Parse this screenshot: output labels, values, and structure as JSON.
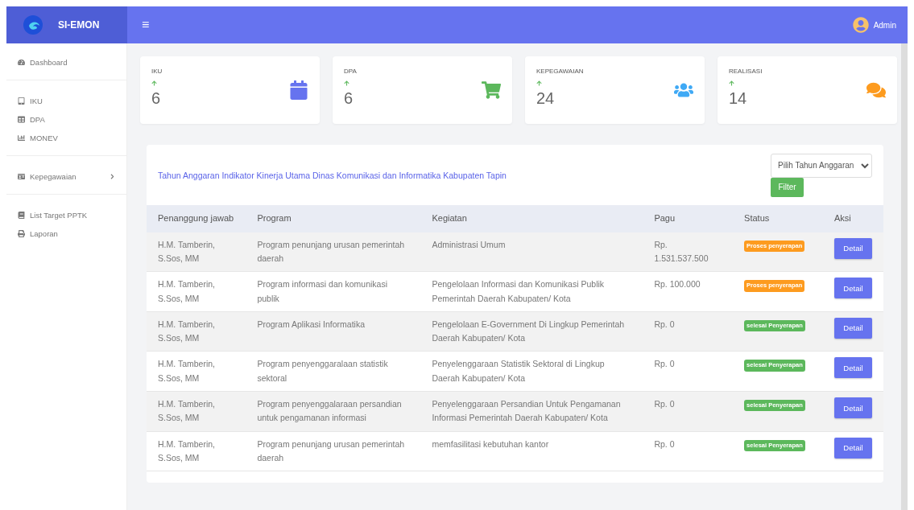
{
  "brand": {
    "name": "SI-EMON"
  },
  "header": {
    "menu_glyph": "≡",
    "user": "Admin"
  },
  "sidebar": {
    "groups": [
      {
        "items": [
          {
            "label": "Dashboard",
            "kind": "link"
          }
        ]
      },
      {
        "items": [
          {
            "label": "IKU",
            "kind": "link"
          },
          {
            "label": "DPA",
            "kind": "link"
          },
          {
            "label": "MONEV",
            "kind": "link"
          }
        ]
      },
      {
        "items": [
          {
            "label": "Kepegawaian",
            "kind": "submenu"
          }
        ]
      },
      {
        "items": [
          {
            "label": "List Target PPTK",
            "kind": "link"
          },
          {
            "label": "Laporan",
            "kind": "link"
          }
        ]
      }
    ]
  },
  "stats": [
    {
      "label": "IKU",
      "value": "6",
      "color": "#6673ef"
    },
    {
      "label": "DPA",
      "value": "6",
      "color": "#5cb85c"
    },
    {
      "label": "KEPEGAWAIAN",
      "value": "24",
      "color": "#3fa9f5"
    },
    {
      "label": "REALISASI",
      "value": "14",
      "color": "#fd9b1f"
    }
  ],
  "panel": {
    "title": "Tahun Anggaran Indikator Kinerja Utama Dinas Komunikasi dan Informatika Kabupaten Tapin",
    "year_select": {
      "placeholder": "Pilih Tahun Anggaran"
    },
    "filter_button": "Filter"
  },
  "table": {
    "columns": [
      "Penanggung jawab",
      "Program",
      "Kegiatan",
      "Pagu",
      "Status",
      "Aksi"
    ],
    "rows": [
      {
        "pj": "H.M. Tamberin, S.Sos, MM",
        "program": "Program penunjang urusan pemerintah daerah",
        "kegiatan": "Administrasi Umum",
        "pagu": "Rp. 1.531.537.500",
        "status": "Proses penyerapan",
        "color": "#fd9b1f",
        "action": "Detail"
      },
      {
        "pj": "H.M. Tamberin, S.Sos, MM",
        "program": "Program informasi dan komunikasi publik",
        "kegiatan": "Pengelolaan Informasi dan Komunikasi Publik Pemerintah Daerah Kabupaten/ Kota",
        "pagu": "Rp. 100.000",
        "status": "Proses penyerapan",
        "color": "#fd9b1f",
        "action": "Detail"
      },
      {
        "pj": "H.M. Tamberin, S.Sos, MM",
        "program": "Program Aplikasi Informatika",
        "kegiatan": "Pengelolaan E-Government Di Lingkup Pemerintah Daerah Kabupaten/ Kota",
        "pagu": "Rp. 0",
        "status": "selesai Penyerapan",
        "color": "#5cb85c",
        "action": "Detail"
      },
      {
        "pj": "H.M. Tamberin, S.Sos, MM",
        "program": "Program penyenggaralaan statistik sektoral",
        "kegiatan": "Penyelenggaraan Statistik Sektoral di Lingkup Daerah Kabupaten/ Kota",
        "pagu": "Rp. 0",
        "status": "selesai Penyerapan",
        "color": "#5cb85c",
        "action": "Detail"
      },
      {
        "pj": "H.M. Tamberin, S.Sos, MM",
        "program": "Program penyenggalaraan persandian untuk pengamanan informasi",
        "kegiatan": "Penyelenggaraan Persandian Untuk Pengamanan Informasi Pemerintah Daerah Kabupaten/ Kota",
        "pagu": "Rp. 0",
        "status": "selesai Penyerapan",
        "color": "#5cb85c",
        "action": "Detail"
      },
      {
        "pj": "H.M. Tamberin, S.Sos, MM",
        "program": "Program penunjang urusan pemerintah daerah",
        "kegiatan": "memfasilitasi kebutuhan kantor",
        "pagu": "Rp. 0",
        "status": "selesai Penyerapan",
        "color": "#5cb85c",
        "action": "Detail"
      }
    ]
  }
}
